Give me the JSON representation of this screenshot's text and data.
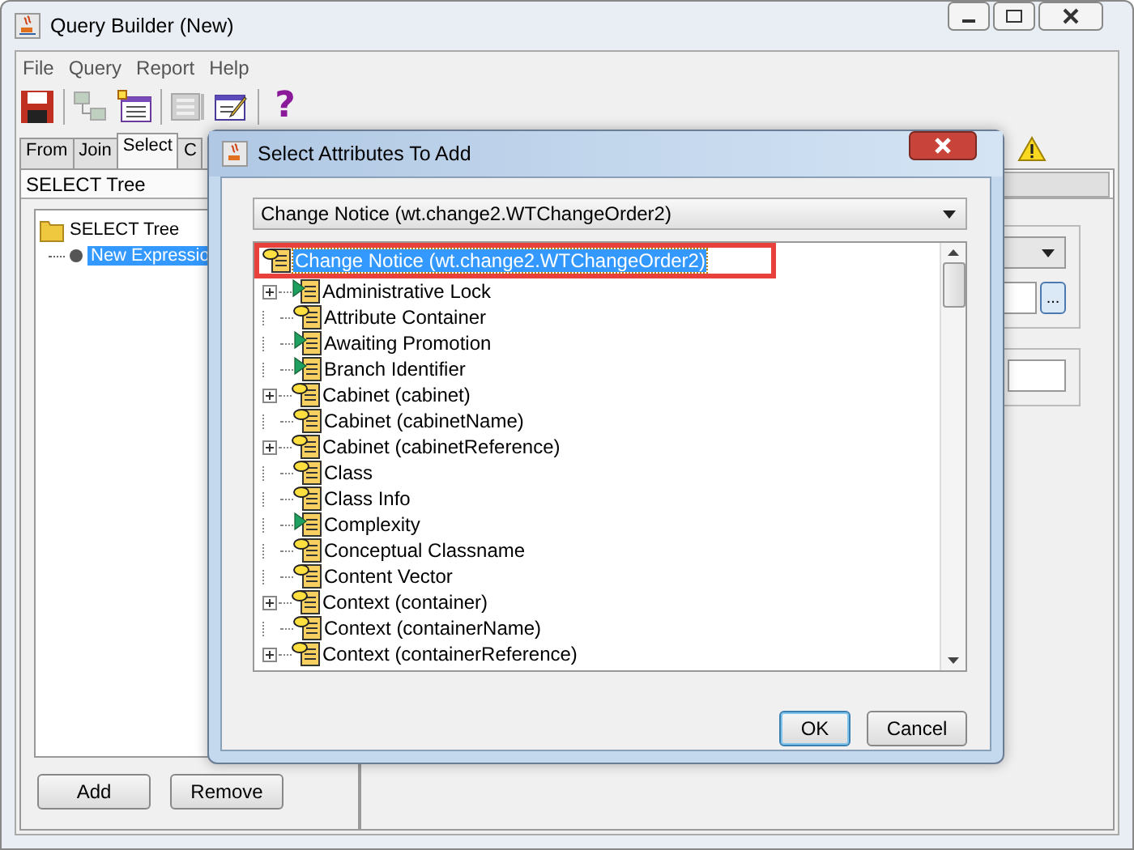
{
  "window": {
    "title": "Query Builder (New)"
  },
  "menu": [
    "File",
    "Query",
    "Report",
    "Help"
  ],
  "toolbar": [
    {
      "kind": "save",
      "disabled": false
    },
    {
      "kind": "diagram",
      "disabled": true
    },
    {
      "kind": "form",
      "disabled": false
    },
    {
      "kind": "panel",
      "disabled": true
    },
    {
      "kind": "edit",
      "disabled": false
    },
    {
      "kind": "help",
      "disabled": false,
      "glyph": "?"
    }
  ],
  "tabs": [
    {
      "label": "From",
      "selected": false
    },
    {
      "label": "Join",
      "selected": false
    },
    {
      "label": "Select",
      "selected": true
    },
    {
      "label": "C",
      "selected": false
    }
  ],
  "select_panel": {
    "header": "SELECT Tree",
    "tree": {
      "label": "SELECT Tree",
      "children": [
        {
          "label": "New Expressio",
          "selected": true
        }
      ]
    },
    "buttons": [
      "Add",
      "Remove"
    ]
  },
  "detail_panel": {
    "browse_glyph": "..."
  },
  "dialog": {
    "title": "Select Attributes To Add",
    "class_select": "Change Notice (wt.change2.WTChangeOrder2)",
    "tree": {
      "label": "Change Notice (wt.change2.WTChangeOrder2)",
      "selected": true,
      "highlighted": true,
      "children": [
        {
          "label": "Administrative Lock",
          "kind": "flagged",
          "expandable": true
        },
        {
          "label": "Attribute Container",
          "kind": "attribute",
          "expandable": false
        },
        {
          "label": "Awaiting Promotion",
          "kind": "flagged",
          "expandable": false
        },
        {
          "label": "Branch Identifier",
          "kind": "flagged",
          "expandable": false
        },
        {
          "label": "Cabinet (cabinet)",
          "kind": "attribute",
          "expandable": true
        },
        {
          "label": "Cabinet (cabinetName)",
          "kind": "attribute",
          "expandable": false
        },
        {
          "label": "Cabinet (cabinetReference)",
          "kind": "attribute",
          "expandable": true
        },
        {
          "label": "Class",
          "kind": "attribute",
          "expandable": false
        },
        {
          "label": "Class Info",
          "kind": "attribute",
          "expandable": false
        },
        {
          "label": "Complexity",
          "kind": "flagged",
          "expandable": false
        },
        {
          "label": "Conceptual Classname",
          "kind": "attribute",
          "expandable": false
        },
        {
          "label": "Content Vector",
          "kind": "attribute",
          "expandable": false
        },
        {
          "label": "Context (container)",
          "kind": "attribute",
          "expandable": true
        },
        {
          "label": "Context (containerName)",
          "kind": "attribute",
          "expandable": false
        },
        {
          "label": "Context (containerReference)",
          "kind": "attribute",
          "expandable": true
        }
      ]
    },
    "buttons": [
      {
        "label": "OK",
        "default": true
      },
      {
        "label": "Cancel",
        "default": false
      }
    ]
  }
}
